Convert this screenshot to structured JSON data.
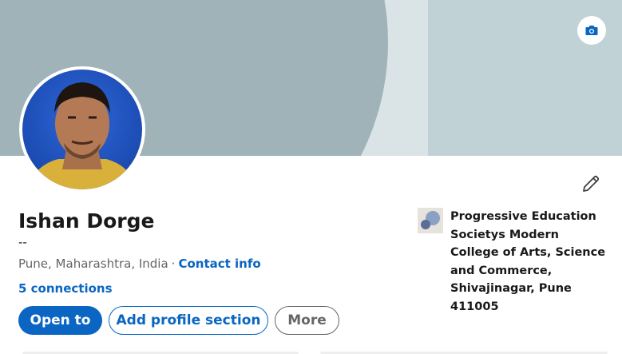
{
  "profile": {
    "name": "Ishan Dorge",
    "headline": "--",
    "location": "Pune, Maharashtra, India",
    "separator": "·",
    "contact_info_label": "Contact info",
    "connections_label": "5 connections"
  },
  "actions": {
    "open_to_label": "Open to",
    "add_section_label": "Add profile section",
    "more_label": "More"
  },
  "education": {
    "school_name": "Progressive Education Societys Modern College of Arts, Science and Commerce, Shivajinagar, Pune 411005"
  },
  "icons": {
    "camera": "camera-icon",
    "edit": "pencil-icon"
  },
  "colors": {
    "accent": "#0a66c2",
    "banner": "#a0b3b8"
  }
}
